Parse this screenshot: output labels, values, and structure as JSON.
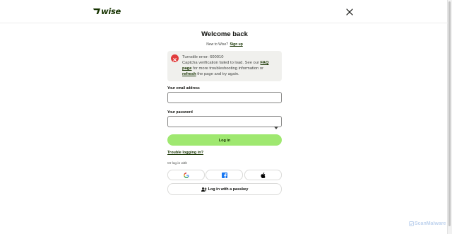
{
  "brand": {
    "logo_text": "wise",
    "logo_color": "#163300"
  },
  "header": {
    "close_icon": "close-icon"
  },
  "main": {
    "title": "Welcome back",
    "subtitle_text": "New to Wise?",
    "signup_link": "Sign up"
  },
  "alert": {
    "icon": "error-x-icon",
    "line1": "Turnstile error: 600010",
    "part1": "Captcha verification failed to load. See our",
    "faq_link": "FAQ page",
    "part2": "for more troubleshooting information or",
    "refresh_link": "refresh",
    "part3": "the page and try again.",
    "bg_color": "#f0f0ed",
    "icon_color": "#e13d3d"
  },
  "form": {
    "email_label": "Your email address",
    "email_value": "",
    "password_label": "Your password",
    "password_value": "",
    "login_button": "Log in",
    "login_button_color": "#9fe870"
  },
  "links": {
    "trouble": "Trouble logging in?",
    "or_login": "Or log in with"
  },
  "social": [
    {
      "name": "google-icon"
    },
    {
      "name": "facebook-icon"
    },
    {
      "name": "apple-icon"
    }
  ],
  "passkey": {
    "label": "Log in with a passkey",
    "icon": "passkey-user-icon"
  },
  "watermark": {
    "text": "ScanMalware"
  }
}
